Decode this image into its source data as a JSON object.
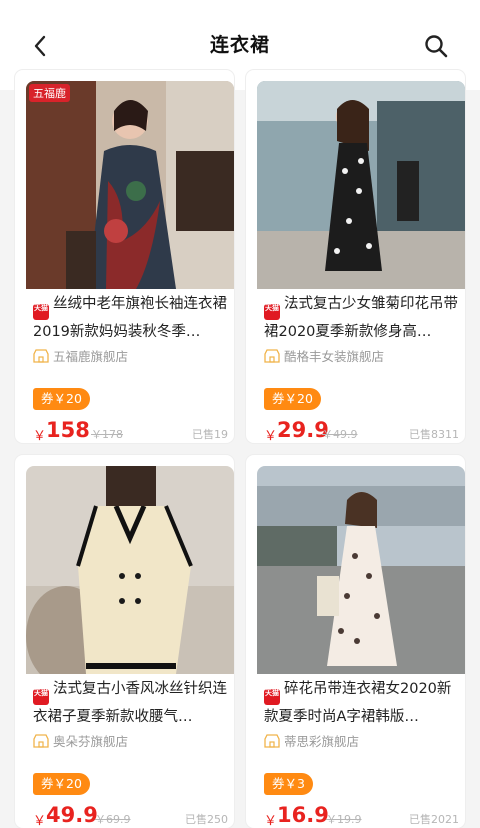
{
  "header": {
    "title": "连衣裙",
    "back_icon": "chevron-left-icon",
    "search_icon": "search-icon"
  },
  "colors": {
    "price": "#e8231f",
    "coupon": "#ff8a12",
    "tmall": "#e01a22"
  },
  "products": [
    {
      "shop_badge": "五福鹿",
      "platform_tag": "天猫",
      "name": "丝绒中老年旗袍长袖连衣裙2019新款妈妈装秋冬季…",
      "shop": "五福鹿旗舰店",
      "coupon": "券￥20",
      "currency": "￥",
      "price": "158",
      "original_price": "￥178",
      "sold": "已售19"
    },
    {
      "shop_badge": "",
      "platform_tag": "天猫",
      "name": "法式复古少女雏菊印花吊带裙2020夏季新款修身高…",
      "shop": "酷格丰女装旗舰店",
      "coupon": "券￥20",
      "currency": "￥",
      "price": "29.9",
      "original_price": "￥49.9",
      "sold": "已售8311"
    },
    {
      "shop_badge": "",
      "platform_tag": "天猫",
      "name": "法式复古小香风冰丝针织连衣裙子夏季新款收腰气…",
      "shop": "奥朵芬旗舰店",
      "coupon": "券￥20",
      "currency": "￥",
      "price": "49.9",
      "original_price": "￥69.9",
      "sold": "已售250"
    },
    {
      "shop_badge": "",
      "platform_tag": "天猫",
      "name": "碎花吊带连衣裙女2020新款夏季时尚A字裙韩版…",
      "shop": "蒂思彩旗舰店",
      "coupon": "券￥3",
      "currency": "￥",
      "price": "16.9",
      "original_price": "￥19.9",
      "sold": "已售2021"
    }
  ]
}
